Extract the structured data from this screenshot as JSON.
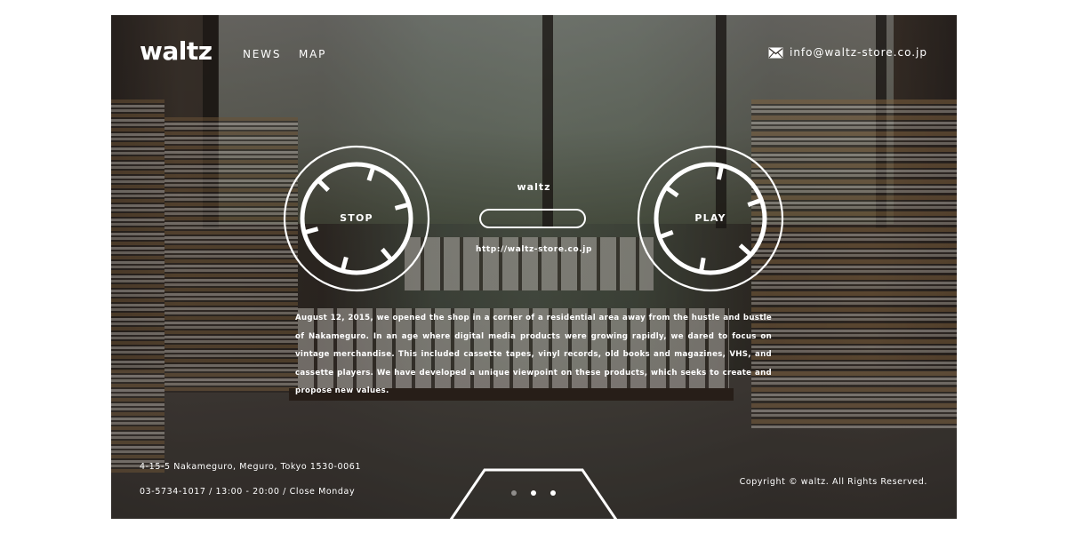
{
  "header": {
    "logo": "waltz",
    "nav": [
      {
        "label": "NEWS"
      },
      {
        "label": "MAP"
      }
    ],
    "email": "info@waltz-store.co.jp",
    "email_icon": "mail-icon"
  },
  "player": {
    "stop_label": "STOP",
    "play_label": "PLAY",
    "brand": "waltz",
    "url": "http://waltz-store.co.jp"
  },
  "about": "August 12, 2015, we opened the shop in a corner of a residential area away from the hustle and bustle of Nakameguro. In an age where digital media products were growing rapidly, we dared to focus on vintage merchandise. This included cassette tapes, vinyl records, old books and magazines, VHS, and cassette players. We have developed a unique viewpoint on these products, which seeks to create and propose new values.",
  "footer": {
    "address": "4-15-5 Nakameguro, Meguro, Tokyo 1530-0061",
    "hours": "03-5734-1017 / 13:00 - 20:00 / Close Monday",
    "copyright": "Copyright © waltz. All Rights Reserved."
  },
  "slider": {
    "dot_count": 3
  },
  "colors": {
    "text": "#ffffff",
    "page_bg": "#ffffff"
  }
}
